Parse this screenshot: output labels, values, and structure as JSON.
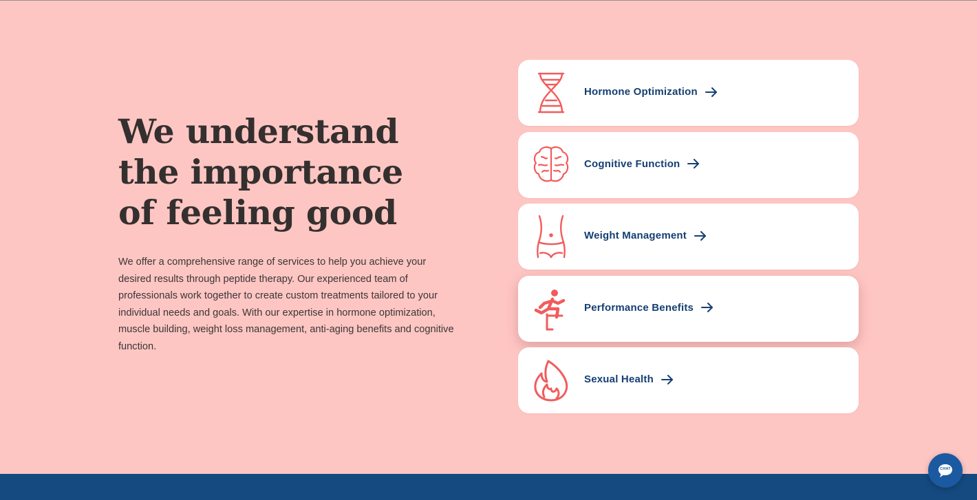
{
  "hero": {
    "headline_lines": [
      "We understand",
      "the importance",
      "of feeling good"
    ],
    "body": "We offer a comprehensive range of services to help you achieve your desired results through peptide therapy. Our experienced team of professionals work together to create custom treatments tailored to your individual needs and goals. With our expertise in hormone optimization, muscle building, weight loss management, anti-aging benefits and cognitive function."
  },
  "services": [
    {
      "label": "Hormone Optimization",
      "icon": "dna-icon"
    },
    {
      "label": "Cognitive Function",
      "icon": "brain-icon"
    },
    {
      "label": "Weight Management",
      "icon": "waist-icon"
    },
    {
      "label": "Performance Benefits",
      "icon": "hurdle-runner-icon"
    },
    {
      "label": "Sexual Health",
      "icon": "flame-icon"
    }
  ],
  "chat": {
    "label": "CHAT",
    "icon": "chat-bubble-icon"
  },
  "colors": {
    "background": "#fec6c3",
    "accent_icon": "#f25b5b",
    "link_text": "#143f72",
    "footer": "#154a80",
    "chat_button": "#1b5aa1"
  }
}
